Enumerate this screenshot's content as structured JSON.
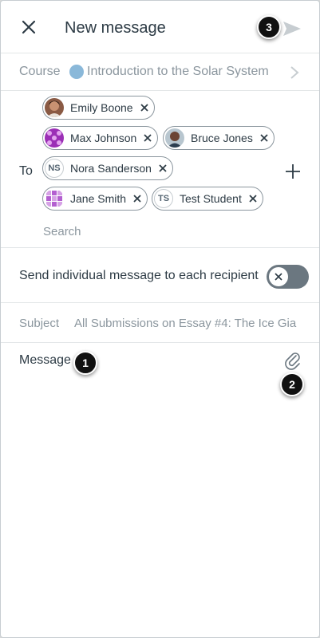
{
  "header": {
    "title": "New message",
    "close_icon": "close-icon",
    "send_icon": "send-icon"
  },
  "course": {
    "label": "Course",
    "name": "Introduction to the Solar System",
    "dot_color": "#8ab8d9"
  },
  "to": {
    "label": "To",
    "recipients": [
      {
        "name": "Emily Boone",
        "initials": ""
      },
      {
        "name": "Max Johnson",
        "initials": ""
      },
      {
        "name": "Bruce Jones",
        "initials": ""
      },
      {
        "name": "Nora Sanderson",
        "initials": "NS"
      },
      {
        "name": "Jane Smith",
        "initials": ""
      },
      {
        "name": "Test Student",
        "initials": "TS"
      }
    ],
    "search_placeholder": "Search"
  },
  "individual": {
    "label": "Send individual message to each recipient",
    "enabled": false
  },
  "subject": {
    "label": "Subject",
    "value": "All Submissions on Essay #4: The Ice Gia"
  },
  "message": {
    "label": "Message",
    "attach_icon": "paperclip-icon"
  },
  "badges": {
    "message": "1",
    "attach": "2",
    "send": "3"
  }
}
